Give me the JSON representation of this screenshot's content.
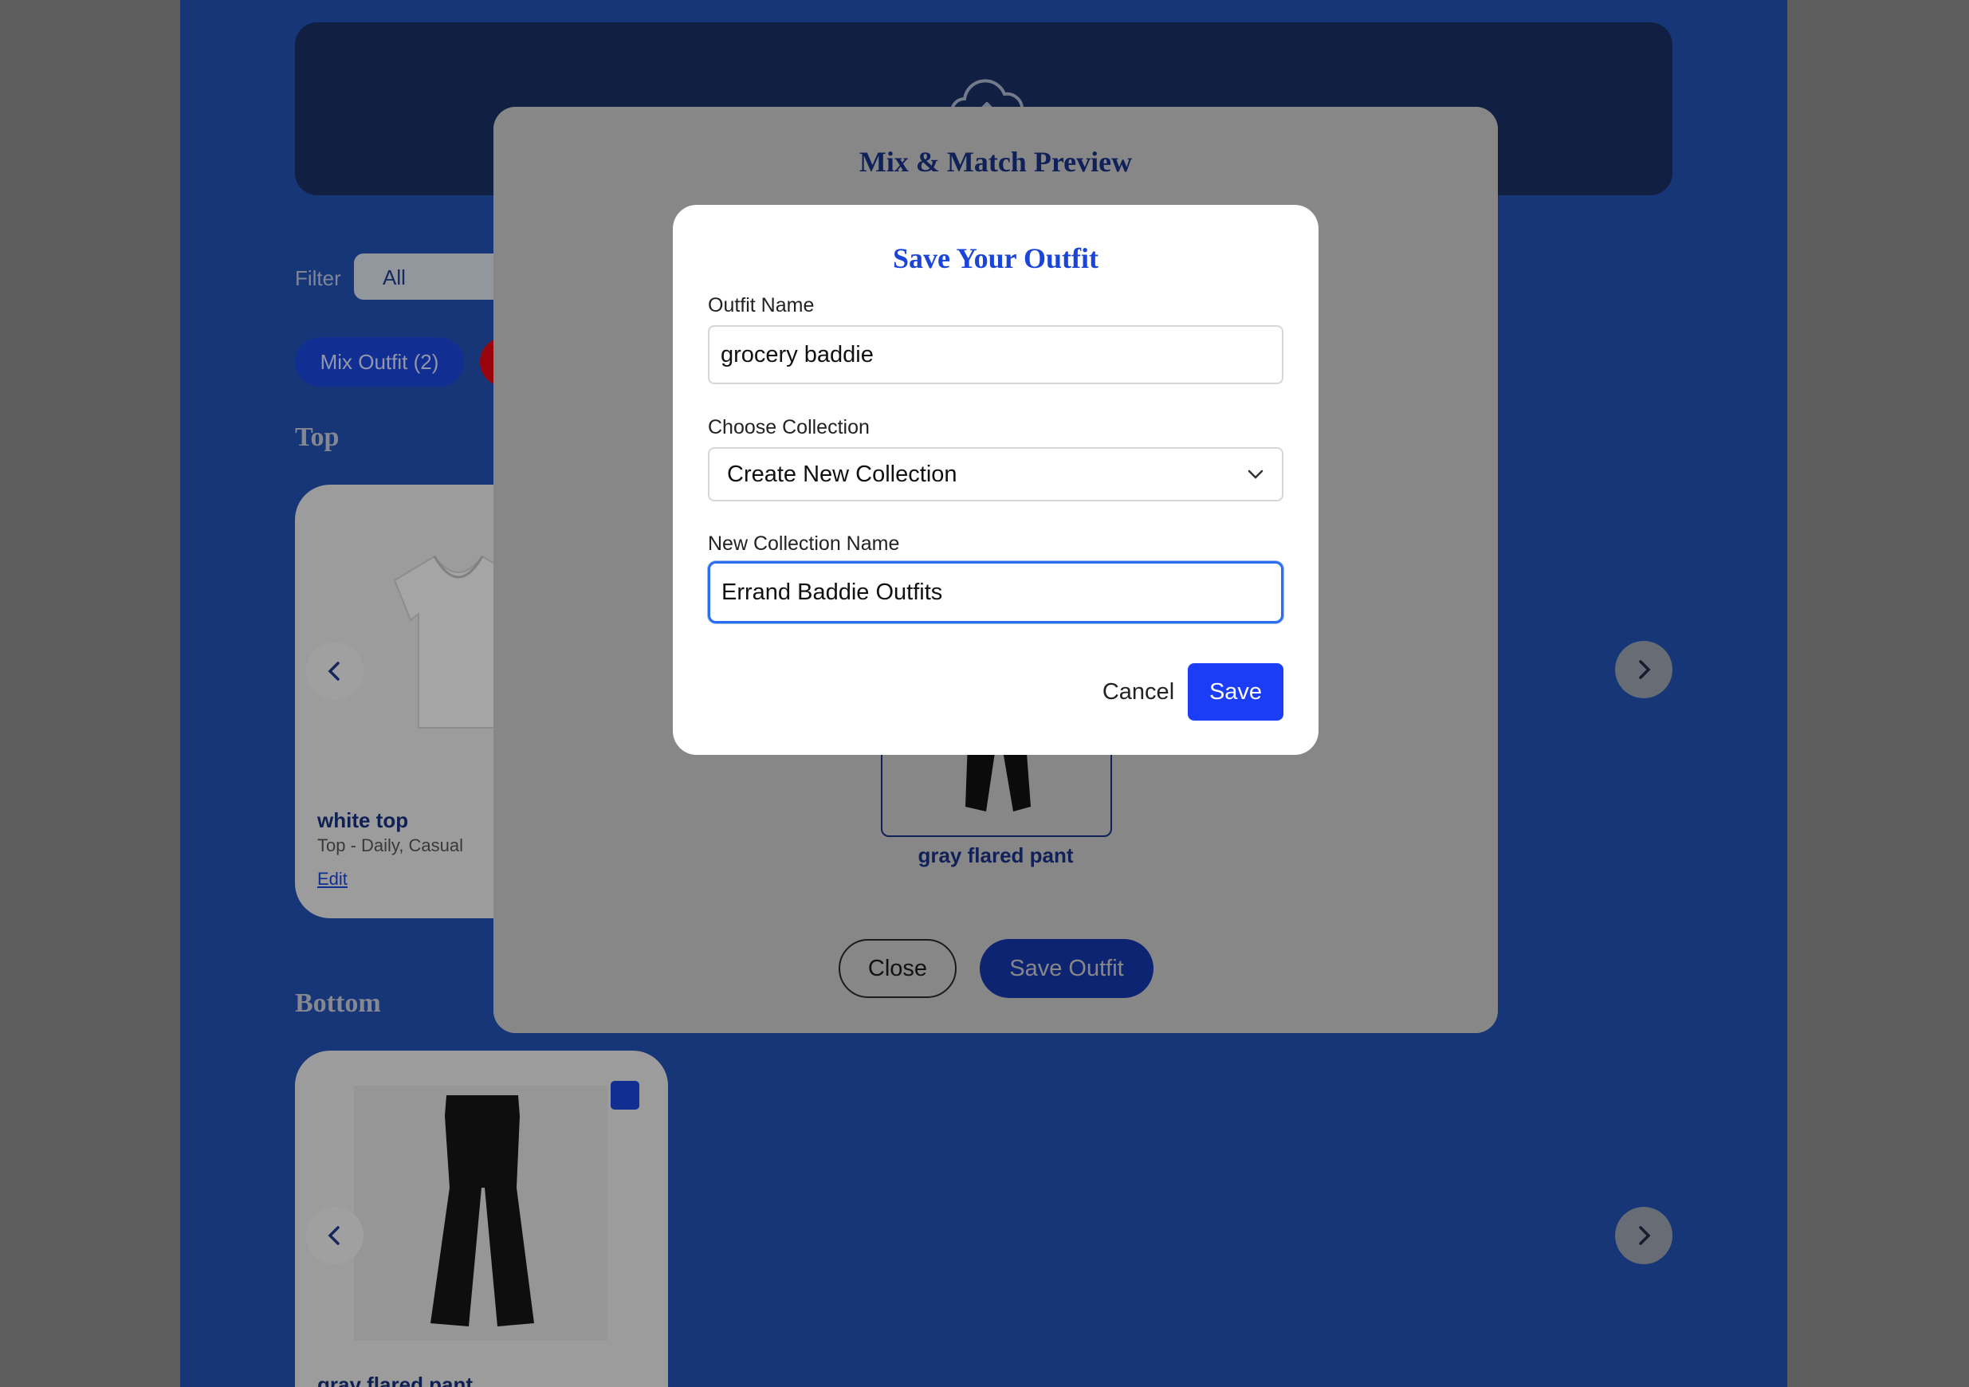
{
  "page": {
    "filter": {
      "label": "Filter",
      "selected": "All"
    },
    "mix_outfit_button": "Mix Outfit (2)",
    "sections": [
      {
        "title": "Top",
        "item": {
          "name": "white top",
          "meta": "Top - Daily, Casual",
          "edit_label": "Edit"
        }
      },
      {
        "title": "Bottom",
        "item": {
          "name": "gray flared pant"
        }
      }
    ]
  },
  "preview_modal": {
    "title": "Mix & Match Preview",
    "item_name": "gray flared pant",
    "close_label": "Close",
    "save_outfit_label": "Save Outfit"
  },
  "save_dialog": {
    "title": "Save Your Outfit",
    "outfit_name": {
      "label": "Outfit Name",
      "value": "grocery baddie"
    },
    "collection": {
      "label": "Choose Collection",
      "selected": "Create New Collection"
    },
    "new_collection_name": {
      "label": "New Collection Name",
      "value": "Errand Baddie Outfits"
    },
    "cancel_label": "Cancel",
    "save_label": "Save"
  },
  "colors": {
    "brand_blue": "#1a45d8",
    "page_background": "#2250b0",
    "focus_ring": "#2a6df0"
  },
  "icons": [
    "cloud-upload-icon",
    "chevron-left-icon",
    "chevron-right-icon",
    "chevron-down-icon"
  ]
}
